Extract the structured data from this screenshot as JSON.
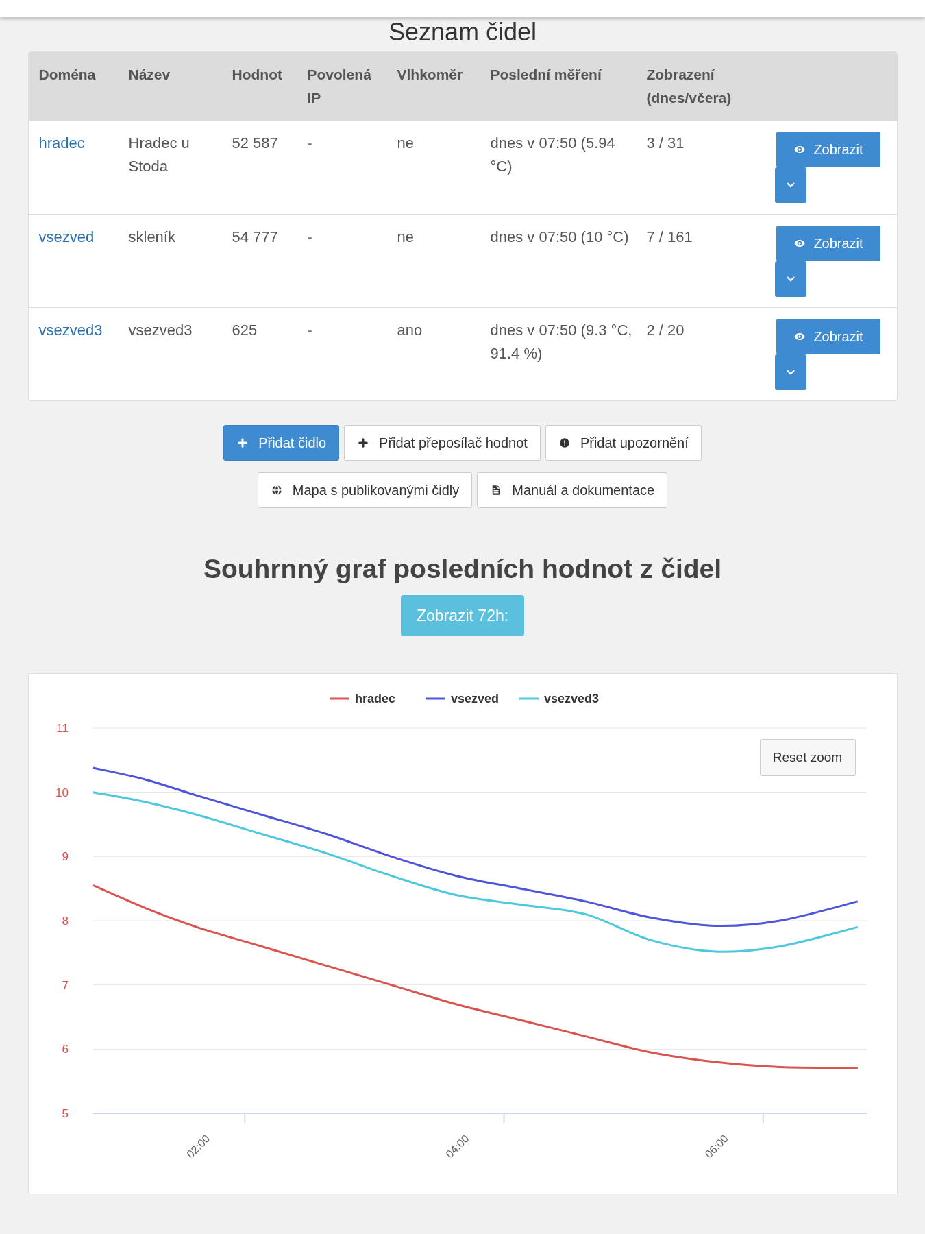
{
  "title": "Seznam čidel",
  "table": {
    "columns": [
      "Doména",
      "Název",
      "Hodnot",
      "Povolená IP",
      "Vlhkoměr",
      "Poslední měření",
      "Zobrazení (dnes/včera)"
    ],
    "rows": [
      {
        "domain": "hradec",
        "name": "Hradec u Stoda",
        "value": "52 587",
        "ip": "-",
        "humidity": "ne",
        "last": "dnes v 07:50 (5.94 °C)",
        "views": "3 / 31",
        "action": "Zobrazit"
      },
      {
        "domain": "vsezved",
        "name": "skleník",
        "value": "54 777",
        "ip": "-",
        "humidity": "ne",
        "last": "dnes v 07:50 (10 °C)",
        "views": "7 / 161",
        "action": "Zobrazit"
      },
      {
        "domain": "vsezved3",
        "name": "vsezved3",
        "value": "625",
        "ip": "-",
        "humidity": "ano",
        "last": "dnes v 07:50 (9.3 °C, 91.4 %)",
        "views": "2 / 20",
        "action": "Zobrazit"
      }
    ]
  },
  "buttons": [
    [
      {
        "label": "Přidat čidlo",
        "kind": "primary"
      },
      {
        "label": "Přidat přeposílač hodnot",
        "kind": "default"
      },
      {
        "label": "Přidat upozornění",
        "kind": "default"
      }
    ],
    [
      {
        "label": "Mapa s publikovanými čidly",
        "kind": "default"
      },
      {
        "label": "Manuál a dokumentace",
        "kind": "default"
      }
    ]
  ],
  "summary": {
    "title": "Souhrnný graf posledních hodnot z čidel",
    "range_button": "Zobrazit 72h:",
    "reset_zoom": "Reset zoom",
    "chart_data": {
      "type": "line",
      "x": [
        1.2,
        1.6,
        2,
        2.5,
        3,
        3.5,
        4,
        4.5,
        5,
        5.5,
        6,
        6.5,
        7.1
      ],
      "xlim": [
        1.2,
        7.17
      ],
      "grid": true,
      "legend": true,
      "ylim": [
        5,
        11
      ],
      "xticks": [
        {
          "value": 2,
          "label": "02:00"
        },
        {
          "value": 4,
          "label": "04:00"
        },
        {
          "value": 6,
          "label": "06:00"
        }
      ],
      "yticks": [
        5,
        6,
        7,
        8,
        9,
        10,
        11
      ],
      "series": [
        {
          "name": "hradec",
          "color": "#d9534f",
          "values": [
            8.55,
            8.2,
            7.9,
            7.6,
            7.3,
            7.0,
            6.7,
            6.45,
            6.2,
            5.95,
            5.8,
            5.72,
            5.71
          ]
        },
        {
          "name": "vsezved",
          "color": "#4f55d8",
          "values": [
            10.38,
            10.2,
            9.95,
            9.65,
            9.35,
            9.0,
            8.7,
            8.5,
            8.3,
            8.05,
            7.92,
            8.0,
            8.3
          ]
        },
        {
          "name": "vsezved3",
          "color": "#4dc8dc",
          "values": [
            10.0,
            9.85,
            9.65,
            9.35,
            9.05,
            8.7,
            8.4,
            8.25,
            8.1,
            7.7,
            7.52,
            7.6,
            7.9
          ]
        }
      ]
    }
  }
}
